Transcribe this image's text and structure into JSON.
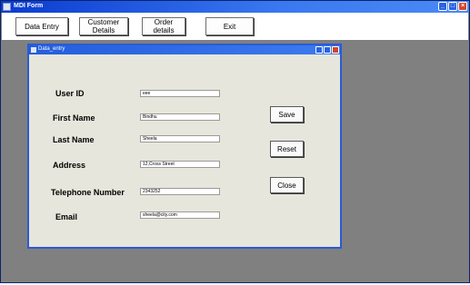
{
  "window": {
    "title": "MDI Form"
  },
  "toolbar": {
    "data_entry": "Data Entry",
    "customer_details": "Customer\nDetails",
    "order_details": "Order\ndetails",
    "exit": "Exit"
  },
  "child": {
    "title": "Data_entry",
    "labels": {
      "user_id": "User ID",
      "first_name": "First Name",
      "last_name": "Last Name",
      "address": "Address",
      "telephone": "Telephone Number",
      "email": "Email"
    },
    "values": {
      "user_id": "eee",
      "first_name": "Bindhu",
      "last_name": "Sheela",
      "address": "12,Cross Street",
      "telephone": "2343252",
      "email": "sheela@city.com"
    },
    "buttons": {
      "save": "Save",
      "reset": "Reset",
      "close": "Close"
    }
  },
  "icons": [
    "app-icon",
    "minimize-icon",
    "maximize-icon",
    "close-icon"
  ]
}
